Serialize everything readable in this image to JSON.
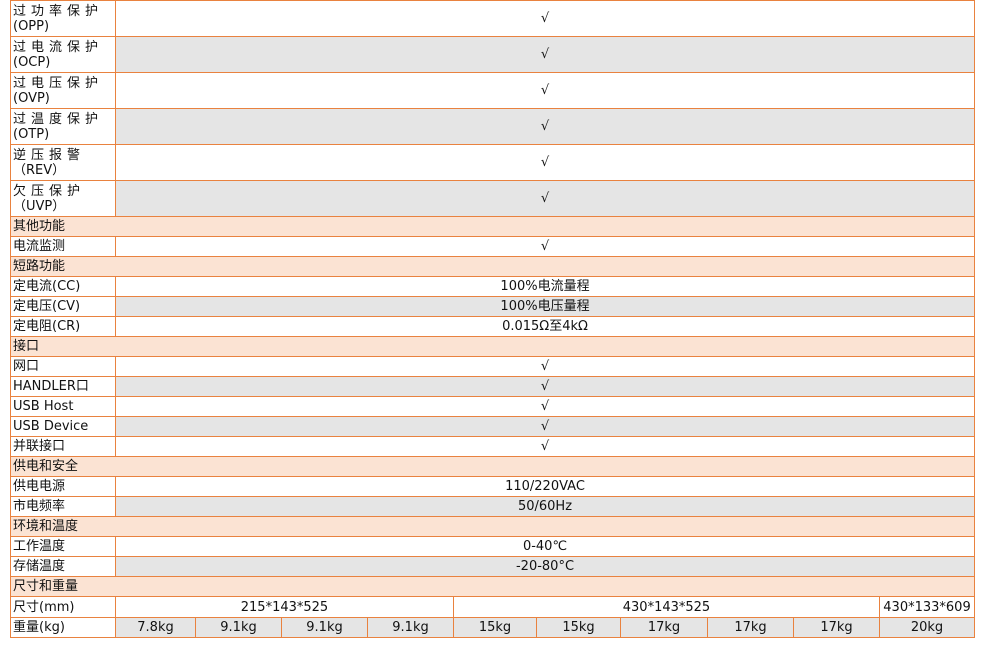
{
  "protection": [
    {
      "zh": "过功率保护",
      "en": "(OPP)",
      "value": "√"
    },
    {
      "zh": "过电流保护",
      "en": "(OCP)",
      "value": "√"
    },
    {
      "zh": "过电压保护",
      "en": "(OVP)",
      "value": "√"
    },
    {
      "zh": "过温度保护",
      "en": "(OTP)",
      "value": "√"
    },
    {
      "zh": "逆压报警",
      "en": "（REV）",
      "value": "√"
    },
    {
      "zh": "欠压保护",
      "en": "（UVP）",
      "value": "√"
    }
  ],
  "sections": [
    {
      "title": "其他功能",
      "rows": [
        {
          "label": "电流监测",
          "value": "√"
        }
      ]
    },
    {
      "title": "短路功能",
      "rows": [
        {
          "label": "定电流(CC)",
          "value": "100%电流量程"
        },
        {
          "label": "定电压(CV)",
          "value": "100%电压量程"
        },
        {
          "label": "定电阻(CR)",
          "value": "0.015Ω至4kΩ"
        }
      ]
    },
    {
      "title": "接口",
      "rows": [
        {
          "label": "网口",
          "value": "√"
        },
        {
          "label": "HANDLER口",
          "value": "√"
        },
        {
          "label": "USB Host",
          "value": "√"
        },
        {
          "label": "USB Device",
          "value": "√"
        },
        {
          "label": "并联接口",
          "value": "√"
        }
      ]
    },
    {
      "title": "供电和安全",
      "rows": [
        {
          "label": "供电电源",
          "value": "110/220VAC"
        },
        {
          "label": "市电频率",
          "value": "50/60Hz"
        }
      ]
    },
    {
      "title": "环境和温度",
      "rows": [
        {
          "label": "工作温度",
          "value": "0-40℃"
        },
        {
          "label": "存储温度",
          "value": "-20-80°C"
        }
      ]
    }
  ],
  "size_weight": {
    "title": "尺寸和重量",
    "size_label": "尺寸(mm)",
    "sizes": [
      "215*143*525",
      "430*143*525",
      "430*133*609"
    ],
    "weight_label": "重量(kg)",
    "weights": [
      "7.8kg",
      "9.1kg",
      "9.1kg",
      "9.1kg",
      "15kg",
      "15kg",
      "17kg",
      "17kg",
      "17kg",
      "20kg"
    ]
  }
}
